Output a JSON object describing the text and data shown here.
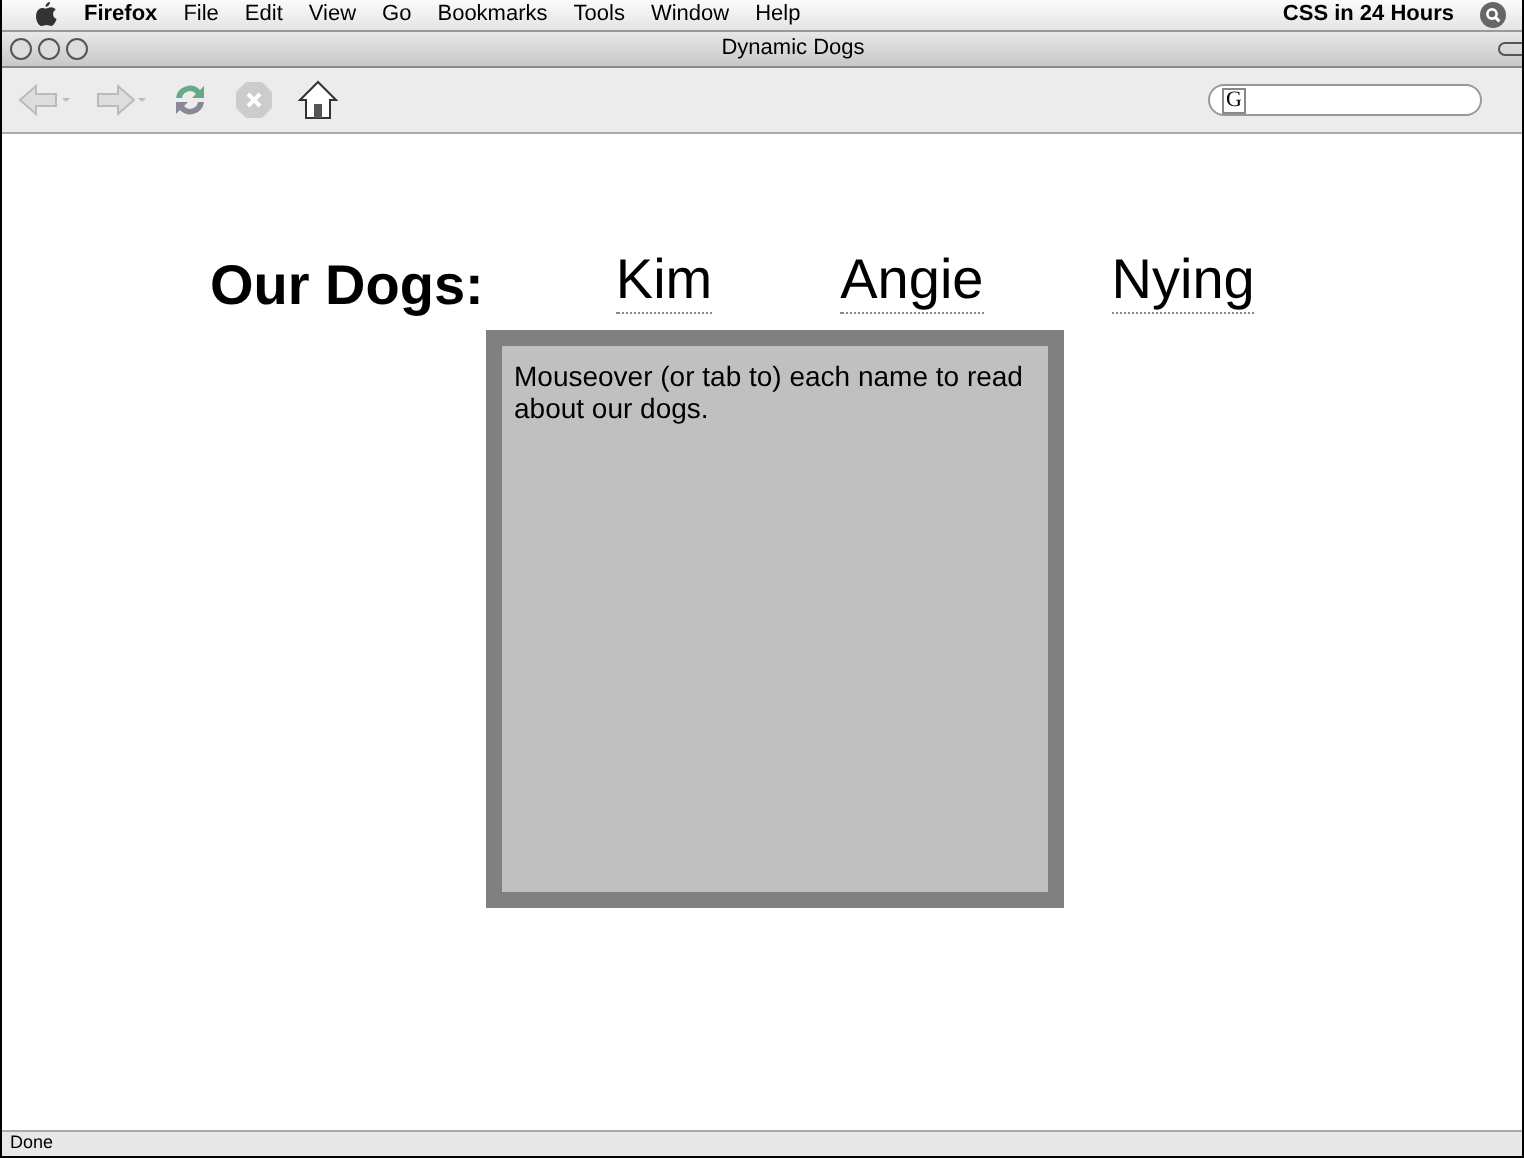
{
  "menu_bar": {
    "app": "Firefox",
    "items": [
      "File",
      "Edit",
      "View",
      "Go",
      "Bookmarks",
      "Tools",
      "Window",
      "Help"
    ],
    "right_text": "CSS in 24 Hours"
  },
  "window": {
    "title": "Dynamic Dogs"
  },
  "toolbar": {
    "search_engine_mark": "G"
  },
  "page": {
    "heading": "Our Dogs:",
    "names": [
      "Kim",
      "Angie",
      "Nying"
    ],
    "info_text": "Mouseover (or tab to) each name to read about our dogs."
  },
  "status_bar": "Done"
}
